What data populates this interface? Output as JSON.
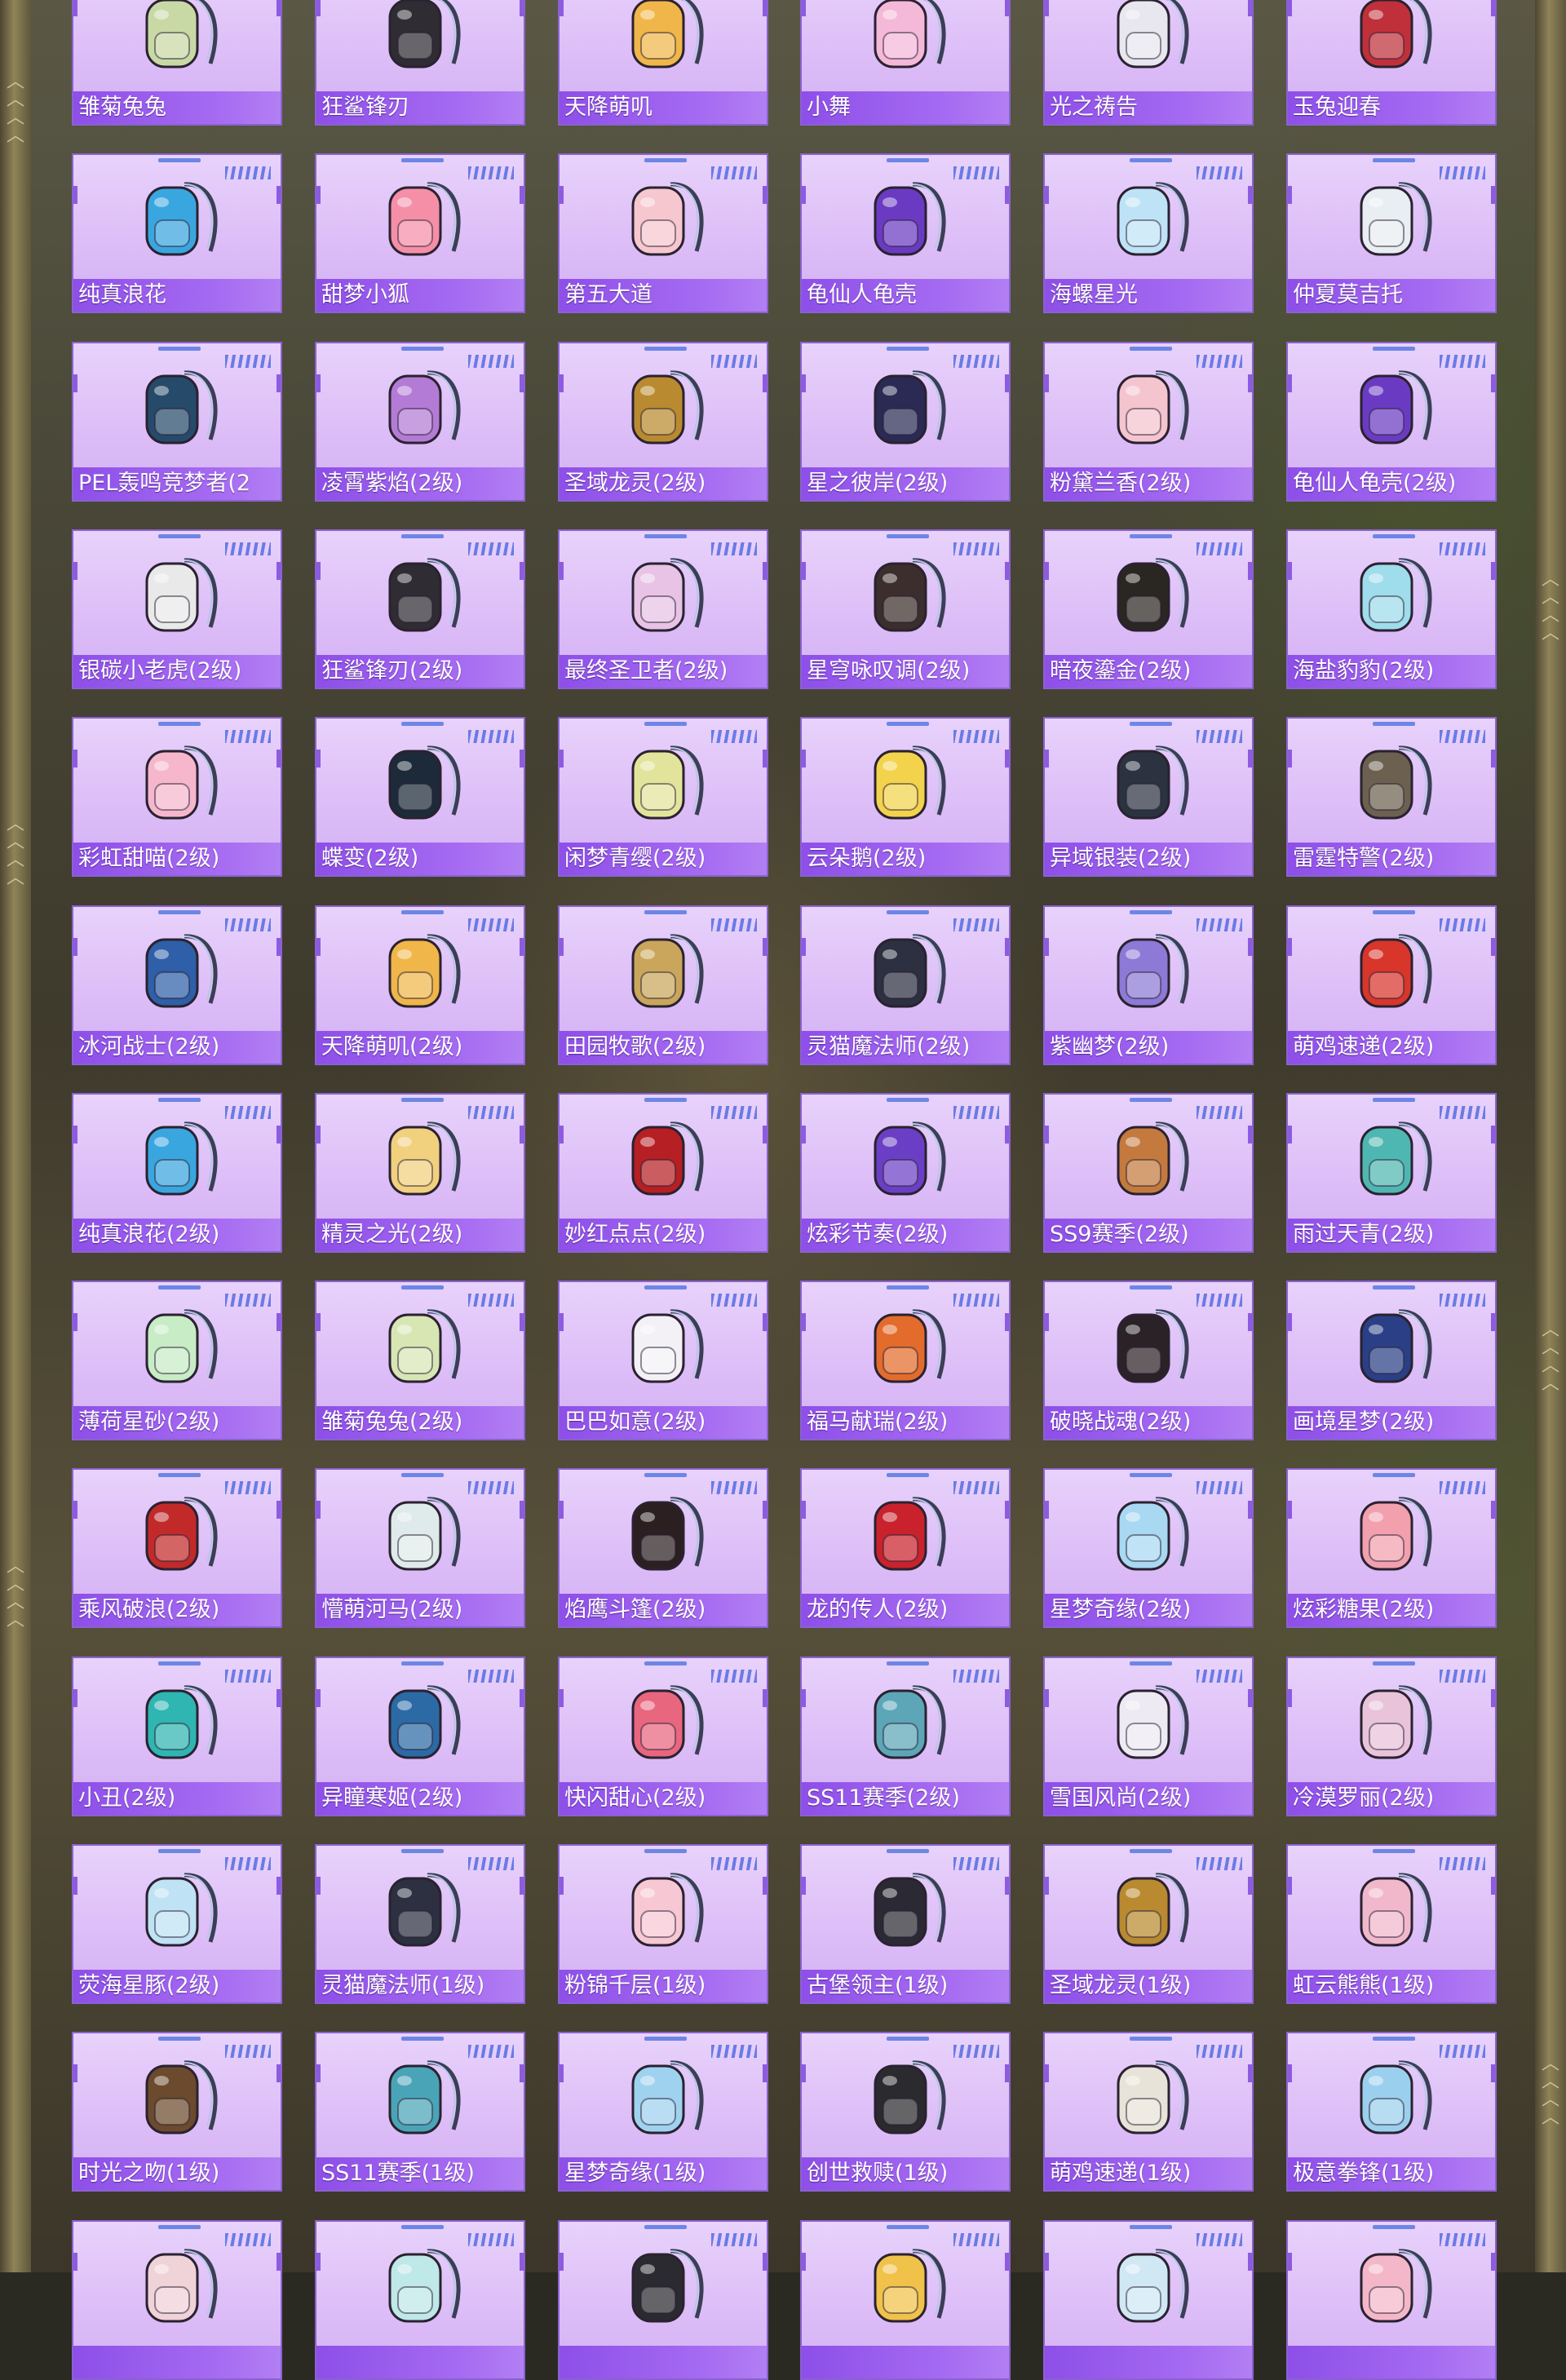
{
  "grid": {
    "rows": [
      [
        {
          "name": "雏菊兔兔",
          "icon": "backpack-icon",
          "color": "#c9d9a6"
        },
        {
          "name": "狂鲨锋刃",
          "icon": "backpack-icon",
          "color": "#2f2c33"
        },
        {
          "name": "天降萌叽",
          "icon": "backpack-icon",
          "color": "#f0b64a"
        },
        {
          "name": "小舞",
          "icon": "backpack-icon",
          "color": "#f4b8d8"
        },
        {
          "name": "光之祷告",
          "icon": "backpack-icon",
          "color": "#e8e6ef"
        },
        {
          "name": "玉兔迎春",
          "icon": "backpack-icon",
          "color": "#c0303a"
        }
      ],
      [
        {
          "name": "纯真浪花",
          "icon": "backpack-icon",
          "color": "#3aa6e0"
        },
        {
          "name": "甜梦小狐",
          "icon": "backpack-icon",
          "color": "#f58fa8"
        },
        {
          "name": "第五大道",
          "icon": "backpack-icon",
          "color": "#f6c7cf"
        },
        {
          "name": "龟仙人龟壳",
          "icon": "backpack-icon",
          "color": "#6a3bc2"
        },
        {
          "name": "海螺星光",
          "icon": "backpack-icon",
          "color": "#bfe3f6"
        },
        {
          "name": "仲夏莫吉托",
          "icon": "backpack-icon",
          "color": "#e9eef2"
        }
      ],
      [
        {
          "name": "PEL轰鸣竞梦者(2",
          "icon": "backpack-icon",
          "color": "#264a6a"
        },
        {
          "name": "凌霄紫焰(2级)",
          "icon": "backpack-icon",
          "color": "#b37bd6"
        },
        {
          "name": "圣域龙灵(2级)",
          "icon": "backpack-icon",
          "color": "#b98a2f"
        },
        {
          "name": "星之彼岸(2级)",
          "icon": "backpack-icon",
          "color": "#2a2a55"
        },
        {
          "name": "粉黛兰香(2级)",
          "icon": "backpack-icon",
          "color": "#f4c4cf"
        },
        {
          "name": "龟仙人龟壳(2级)",
          "icon": "backpack-icon",
          "color": "#6a3bc2"
        }
      ],
      [
        {
          "name": "银碳小老虎(2级)",
          "icon": "backpack-icon",
          "color": "#e9e9e9"
        },
        {
          "name": "狂鲨锋刃(2级)",
          "icon": "backpack-icon",
          "color": "#2f2c33"
        },
        {
          "name": "最终圣卫者(2级)",
          "icon": "backpack-icon",
          "color": "#e8c3e6"
        },
        {
          "name": "星穹咏叹调(2级)",
          "icon": "backpack-icon",
          "color": "#3b2e2c"
        },
        {
          "name": "暗夜鎏金(2级)",
          "icon": "backpack-icon",
          "color": "#2a2622"
        },
        {
          "name": "海盐豹豹(2级)",
          "icon": "backpack-icon",
          "color": "#9fdcec"
        }
      ],
      [
        {
          "name": "彩虹甜喵(2级)",
          "icon": "backpack-icon",
          "color": "#f6b7cd"
        },
        {
          "name": "蝶变(2级)",
          "icon": "backpack-icon",
          "color": "#1d2a3a"
        },
        {
          "name": "闲梦青缨(2级)",
          "icon": "backpack-icon",
          "color": "#e2e49b"
        },
        {
          "name": "云朵鹅(2级)",
          "icon": "backpack-icon",
          "color": "#f3d34c"
        },
        {
          "name": "异域银装(2级)",
          "icon": "backpack-icon",
          "color": "#2b3340"
        },
        {
          "name": "雷霆特警(2级)",
          "icon": "backpack-icon",
          "color": "#6c6150"
        }
      ],
      [
        {
          "name": "冰河战士(2级)",
          "icon": "backpack-icon",
          "color": "#2e5fa8"
        },
        {
          "name": "天降萌叽(2级)",
          "icon": "backpack-icon",
          "color": "#f0b64a"
        },
        {
          "name": "田园牧歌(2级)",
          "icon": "backpack-icon",
          "color": "#c9a65b"
        },
        {
          "name": "灵猫魔法师(2级)",
          "icon": "backpack-icon",
          "color": "#2c3040"
        },
        {
          "name": "紫幽梦(2级)",
          "icon": "backpack-icon",
          "color": "#8c7ad6"
        },
        {
          "name": "萌鸡速递(2级)",
          "icon": "backpack-icon",
          "color": "#d8352b"
        }
      ],
      [
        {
          "name": "纯真浪花(2级)",
          "icon": "backpack-icon",
          "color": "#3aa6e0"
        },
        {
          "name": "精灵之光(2级)",
          "icon": "backpack-icon",
          "color": "#f1d07e"
        },
        {
          "name": "妙红点点(2级)",
          "icon": "backpack-icon",
          "color": "#b61f23"
        },
        {
          "name": "炫彩节奏(2级)",
          "icon": "backpack-icon",
          "color": "#6b3fc5"
        },
        {
          "name": "SS9赛季(2级)",
          "icon": "backpack-icon",
          "color": "#c47a3e"
        },
        {
          "name": "雨过天青(2级)",
          "icon": "backpack-icon",
          "color": "#4fb7b1"
        }
      ],
      [
        {
          "name": "薄荷星砂(2级)",
          "icon": "backpack-icon",
          "color": "#c8ecc6"
        },
        {
          "name": "雏菊兔兔(2级)",
          "icon": "backpack-icon",
          "color": "#d8e6b4"
        },
        {
          "name": "巴巴如意(2级)",
          "icon": "backpack-icon",
          "color": "#f3f1f6"
        },
        {
          "name": "福马献瑞(2级)",
          "icon": "backpack-icon",
          "color": "#e36b2c"
        },
        {
          "name": "破晓战魂(2级)",
          "icon": "backpack-icon",
          "color": "#2a2226"
        },
        {
          "name": "画境星梦(2级)",
          "icon": "backpack-icon",
          "color": "#2a3f86"
        }
      ],
      [
        {
          "name": "乘风破浪(2级)",
          "icon": "backpack-icon",
          "color": "#c22a2a"
        },
        {
          "name": "懵萌河马(2级)",
          "icon": "backpack-icon",
          "color": "#dfeaea"
        },
        {
          "name": "焰鹰斗篷(2级)",
          "icon": "backpack-icon",
          "color": "#2b1f22"
        },
        {
          "name": "龙的传人(2级)",
          "icon": "backpack-icon",
          "color": "#c9222c"
        },
        {
          "name": "星梦奇缘(2级)",
          "icon": "backpack-icon",
          "color": "#a8d8f2"
        },
        {
          "name": "炫彩糖果(2级)",
          "icon": "backpack-icon",
          "color": "#f2a0ae"
        }
      ],
      [
        {
          "name": "小丑(2级)",
          "icon": "backpack-icon",
          "color": "#2fb5b2"
        },
        {
          "name": "异瞳寒姬(2级)",
          "icon": "backpack-icon",
          "color": "#2c6aa6"
        },
        {
          "name": "快闪甜心(2级)",
          "icon": "backpack-icon",
          "color": "#e8667e"
        },
        {
          "name": "SS11赛季(2级)",
          "icon": "backpack-icon",
          "color": "#5ca6b8"
        },
        {
          "name": "雪国风尚(2级)",
          "icon": "backpack-icon",
          "color": "#eeeaf3"
        },
        {
          "name": "冷漠罗丽(2级)",
          "icon": "backpack-icon",
          "color": "#e9c3da"
        }
      ],
      [
        {
          "name": "荧海星豚(2级)",
          "icon": "backpack-icon",
          "color": "#bfe2f4"
        },
        {
          "name": "灵猫魔法师(1级)",
          "icon": "backpack-icon",
          "color": "#2c3040"
        },
        {
          "name": "粉锦千层(1级)",
          "icon": "backpack-icon",
          "color": "#f7c7d4"
        },
        {
          "name": "古堡领主(1级)",
          "icon": "backpack-icon",
          "color": "#2b2a34"
        },
        {
          "name": "圣域龙灵(1级)",
          "icon": "backpack-icon",
          "color": "#b98a2f"
        },
        {
          "name": "虹云熊熊(1级)",
          "icon": "backpack-icon",
          "color": "#f1b8cb"
        }
      ],
      [
        {
          "name": "时光之吻(1级)",
          "icon": "backpack-icon",
          "color": "#6b4a2d"
        },
        {
          "name": "SS11赛季(1级)",
          "icon": "backpack-icon",
          "color": "#4aa4b8"
        },
        {
          "name": "星梦奇缘(1级)",
          "icon": "backpack-icon",
          "color": "#9fd2ef"
        },
        {
          "name": "创世救赎(1级)",
          "icon": "backpack-icon",
          "color": "#2a2a2f"
        },
        {
          "name": "萌鸡速递(1级)",
          "icon": "backpack-icon",
          "color": "#e8e3d8"
        },
        {
          "name": "极意拳锋(1级)",
          "icon": "backpack-icon",
          "color": "#9ad0ee"
        }
      ],
      [
        {
          "name": "",
          "icon": "backpack-icon",
          "color": "#f0d2d9"
        },
        {
          "name": "",
          "icon": "backpack-icon",
          "color": "#bfe8e8"
        },
        {
          "name": "",
          "icon": "backpack-icon",
          "color": "#2a2a30"
        },
        {
          "name": "",
          "icon": "backpack-icon",
          "color": "#f0c24a"
        },
        {
          "name": "",
          "icon": "backpack-icon",
          "color": "#cfe8f4"
        },
        {
          "name": "",
          "icon": "backpack-icon",
          "color": "#f4b7c9"
        }
      ]
    ]
  },
  "theme": {
    "card_bg": "#e0c4f8",
    "label_bg": "#9b5ef0",
    "card_border": "#8a62d0",
    "accent_stripes": "#6a7be5"
  }
}
